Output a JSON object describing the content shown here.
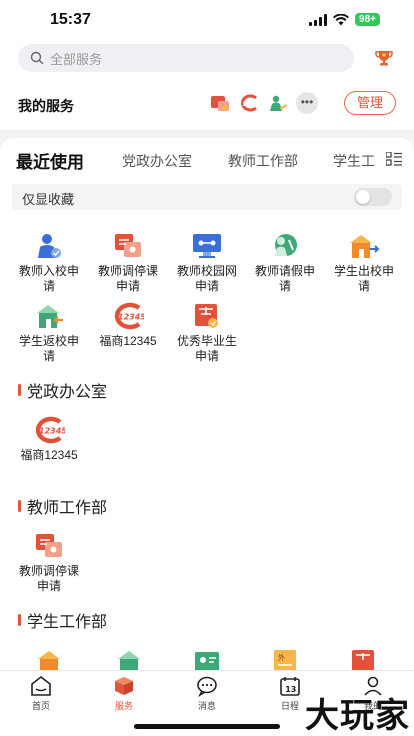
{
  "status": {
    "time": "15:37",
    "battery": "98+"
  },
  "search": {
    "placeholder": "全部服务"
  },
  "my_services": {
    "title": "我的服务",
    "more": "•••",
    "manage_label": "管理"
  },
  "tabs": [
    "最近使用",
    "党政办公室",
    "教师工作部",
    "学生工"
  ],
  "favorites_only": {
    "label": "仅显收藏",
    "enabled": false
  },
  "recent": [
    {
      "label1": "教师入校申",
      "label2": "请",
      "icon": "teacher-entry-icon"
    },
    {
      "label1": "教师调停课",
      "label2": "申请",
      "icon": "class-adjust-icon"
    },
    {
      "label1": "教师校园网",
      "label2": "申请",
      "icon": "campus-network-icon"
    },
    {
      "label1": "教师请假申",
      "label2": "请",
      "icon": "leave-request-icon"
    },
    {
      "label1": "学生出校申",
      "label2": "请",
      "icon": "student-exit-icon"
    },
    {
      "label1": "学生返校申",
      "label2": "请",
      "icon": "student-return-icon"
    },
    {
      "label1": "福商12345",
      "label2": "",
      "icon": "fushang-12345-icon"
    },
    {
      "label1": "优秀毕业生",
      "label2": "申请",
      "icon": "graduate-award-icon"
    }
  ],
  "sections": [
    {
      "title": "党政办公室",
      "items": [
        {
          "label1": "福商12345",
          "label2": ""
        }
      ]
    },
    {
      "title": "教师工作部",
      "items": [
        {
          "label1": "教师调停课",
          "label2": "申请"
        }
      ]
    },
    {
      "title": "学生工作部"
    }
  ],
  "tabbar": [
    {
      "label": "首页",
      "icon": "home-icon"
    },
    {
      "label": "服务",
      "icon": "service-box-icon",
      "active": true
    },
    {
      "label": "消息",
      "icon": "message-icon"
    },
    {
      "label": "日程",
      "icon": "calendar-icon",
      "date": "13"
    },
    {
      "label": "我的",
      "icon": "profile-icon"
    }
  ],
  "watermark": "大玩家",
  "colors": {
    "accent": "#e1553a",
    "blue": "#3b6fd8",
    "green": "#3fa878",
    "orange": "#f08a2c",
    "red": "#e2523a"
  }
}
